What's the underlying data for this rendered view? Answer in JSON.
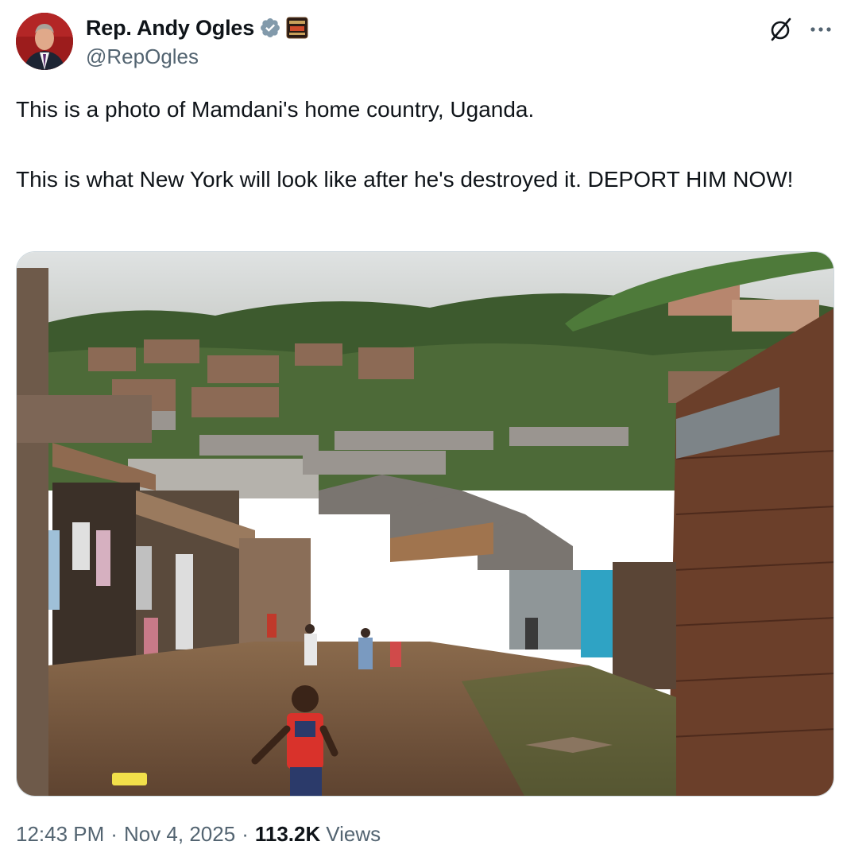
{
  "author": {
    "display_name": "Rep. Andy Ogles",
    "handle": "@RepOgles",
    "verified_icon": "verified-badge-gray",
    "affiliate_icon": "house-of-representatives-badge",
    "avatar_alt": "avatar of man in suit"
  },
  "tweet": {
    "paragraph_1": "This is a photo of Mamdani's home country, Uganda.",
    "paragraph_2": "This is what New York will look like after he's destroyed it. DEPORT HIM NOW!"
  },
  "media": {
    "kind": "photo",
    "description_icon": "photo-image"
  },
  "meta": {
    "time": "12:43 PM",
    "separator": "·",
    "date": "Nov 4, 2025",
    "views_count": "113.2K",
    "views_label": "Views"
  },
  "icons": {
    "grok": "grok-icon",
    "more": "more-icon"
  },
  "colors": {
    "text": "#0f1419",
    "secondary": "#536471",
    "verified": "#829aab"
  }
}
